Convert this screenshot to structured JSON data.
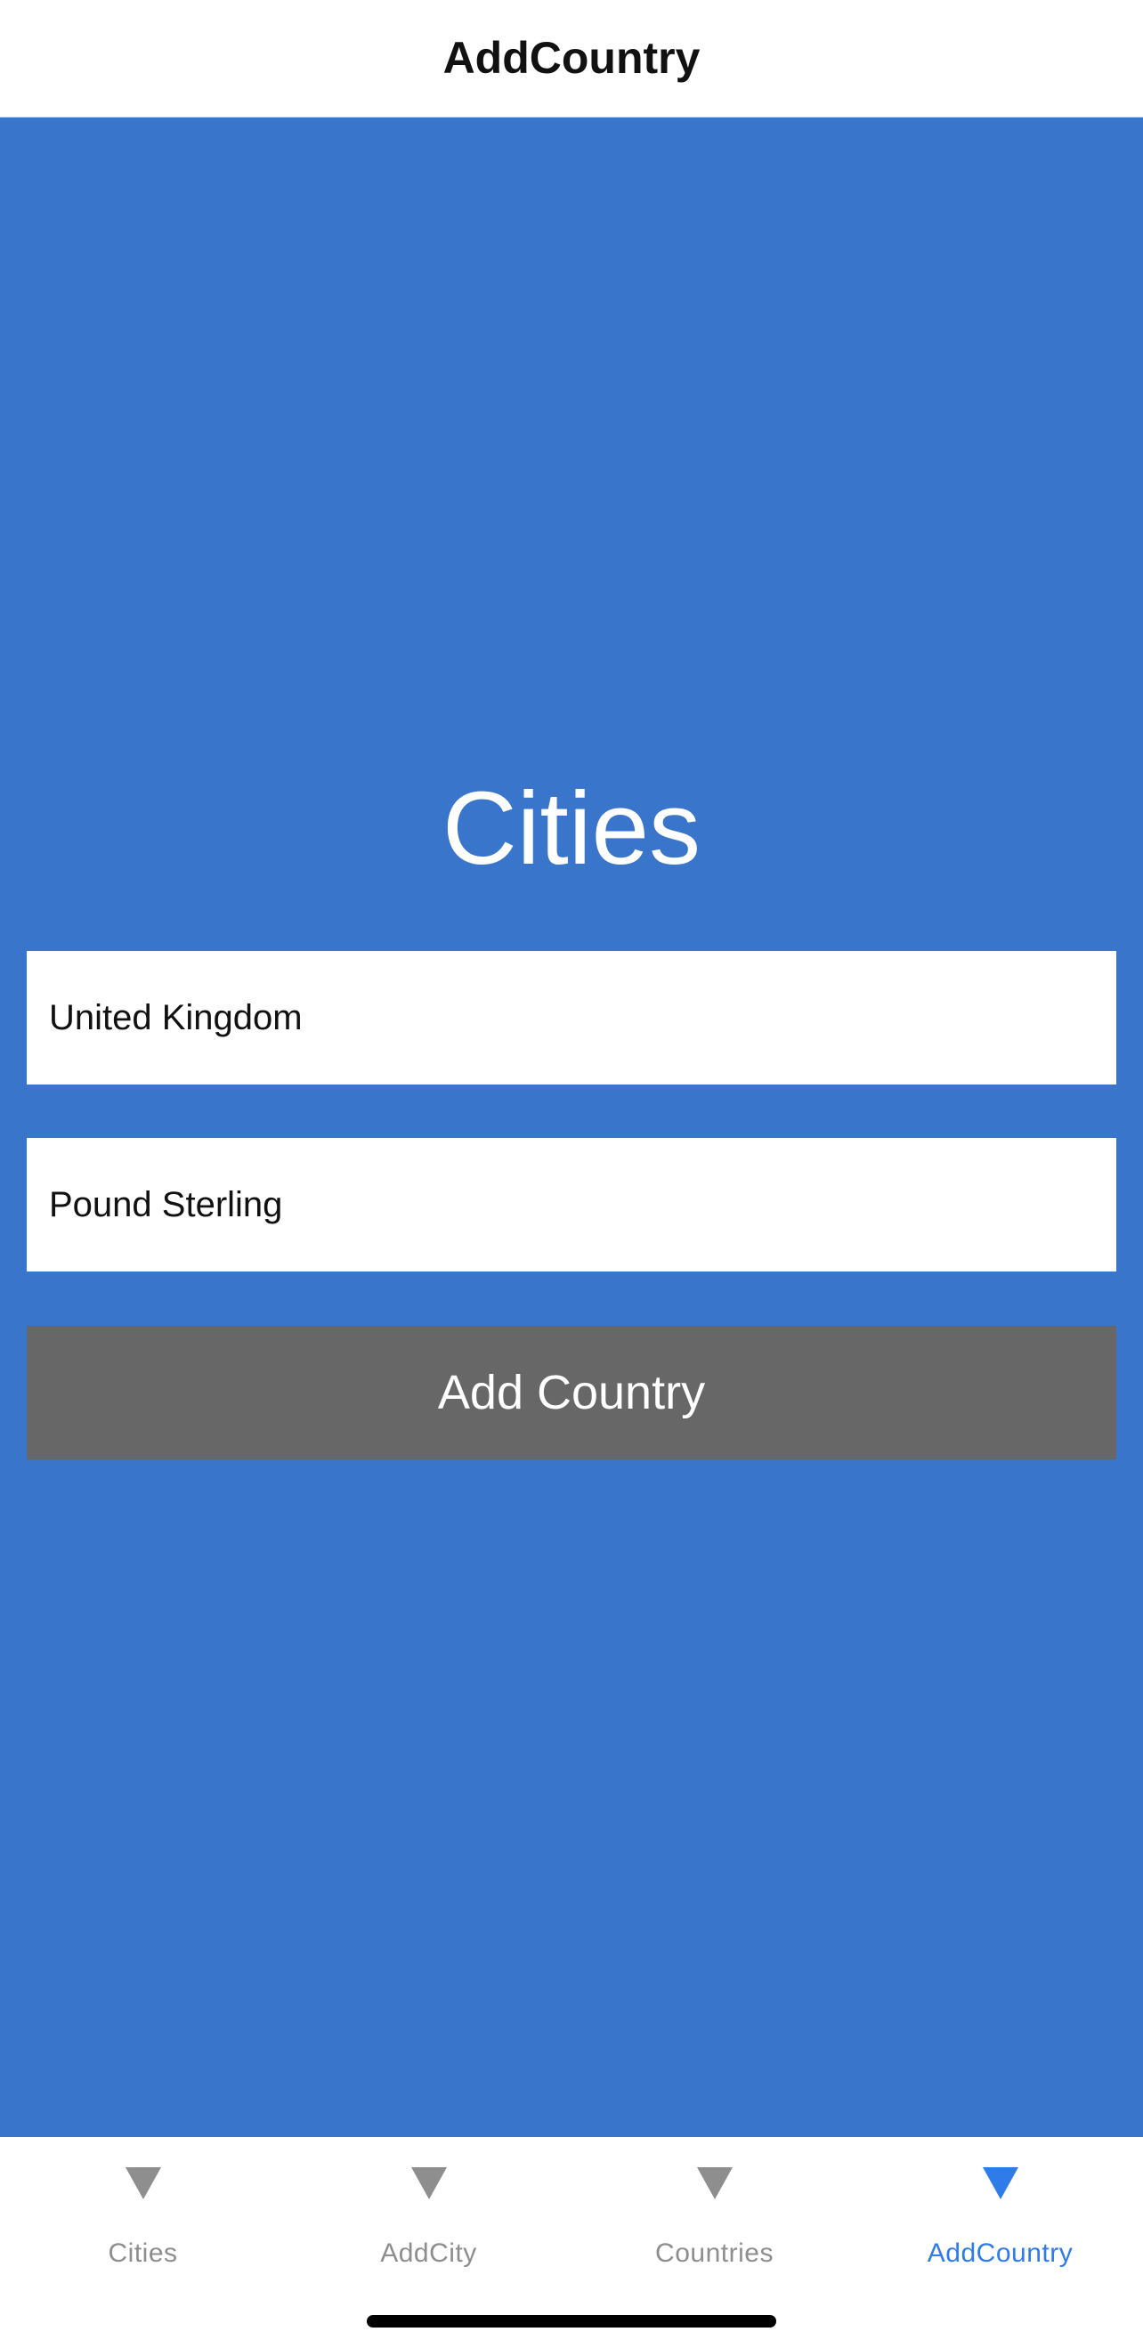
{
  "header": {
    "title": "AddCountry"
  },
  "main": {
    "heading": "Cities",
    "country_field": {
      "value": "United Kingdom"
    },
    "currency_field": {
      "value": "Pound Sterling"
    },
    "add_button_label": "Add Country"
  },
  "tabs": [
    {
      "label": "Cities",
      "icon": "triangle-down-icon",
      "active": false
    },
    {
      "label": "AddCity",
      "icon": "triangle-down-icon",
      "active": false
    },
    {
      "label": "Countries",
      "icon": "triangle-down-icon",
      "active": false
    },
    {
      "label": "AddCountry",
      "icon": "triangle-down-icon",
      "active": true
    }
  ],
  "colors": {
    "background": "#3a75cc",
    "button": "#676767",
    "tab_active": "#2f7bea",
    "tab_inactive": "#8e8e8e"
  }
}
